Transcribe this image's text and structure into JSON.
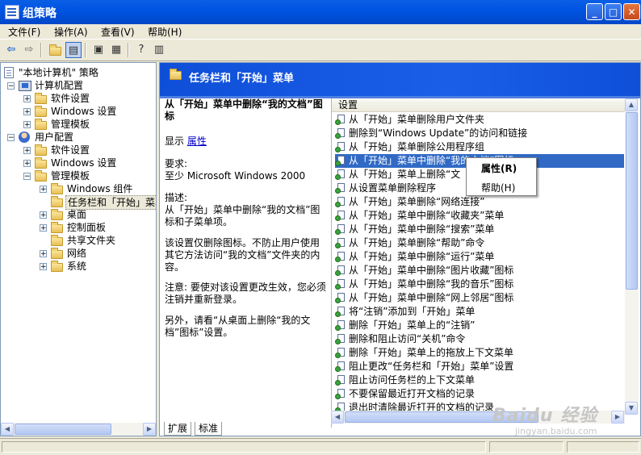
{
  "window": {
    "title": "组策略"
  },
  "menu": [
    "文件(F)",
    "操作(A)",
    "查看(V)",
    "帮助(H)"
  ],
  "toolbar": {
    "back": "⇦",
    "forward": "⇨"
  },
  "tree": {
    "root": "\"本地计算机\" 策略",
    "computer": "计算机配置",
    "c_software": "软件设置",
    "c_windows": "Windows 设置",
    "c_admin": "管理模板",
    "user": "用户配置",
    "u_software": "软件设置",
    "u_windows": "Windows 设置",
    "u_admin": "管理模板",
    "win_comp": "Windows 组件",
    "taskbar": "任务栏和「开始」菜单",
    "desktop": "桌面",
    "control": "控制面板",
    "shared": "共享文件夹",
    "network": "网络",
    "system": "系统"
  },
  "header": {
    "title": "任务栏和「开始」菜单"
  },
  "desc": {
    "title": "从「开始」菜单中删除“我的文档”图标",
    "show_label": "显示",
    "show_link": "属性",
    "req_label": "要求:",
    "req_text": "至少 Microsoft Windows 2000",
    "desc_label": "描述:",
    "desc_text": "从「开始」菜单中删除“我的文档”图标和子菜单项。",
    "p2": "该设置仅删除图标。不防止用户使用其它方法访问“我的文档”文件夹的内容。",
    "p3": "注意: 要使对该设置更改生效，您必须注销并重新登录。",
    "p4": "另外，请看“从桌面上删除“我的文档”图标”设置。"
  },
  "list": {
    "header": "设置",
    "items": [
      "从「开始」菜单删除用户文件夹",
      "删除到“Windows Update”的访问和链接",
      "从「开始」菜单删除公用程序组",
      "从「开始」菜单中删除“我的文档”图标",
      "从「开始」菜单上删除“文",
      "从设置菜单删除程序",
      "从「开始」菜单删除“网络连接”",
      "从「开始」菜单中删除“收藏夹”菜单",
      "从「开始」菜单中删除“搜索”菜单",
      "从「开始」菜单删除“帮助”命令",
      "从「开始」菜单中删除“运行”菜单",
      "从「开始」菜单中删除“图片收藏”图标",
      "从「开始」菜单中删除“我的音乐”图标",
      "从「开始」菜单中删除“网上邻居”图标",
      "将“注销”添加到「开始」菜单",
      "删除「开始」菜单上的“注销”",
      "删除和阻止访问“关机”命令",
      "删除「开始」菜单上的拖放上下文菜单",
      "阻止更改“任务栏和「开始」菜单”设置",
      "阻止访问任务栏的上下文菜单",
      "不要保留最近打开文档的记录",
      "退出时清除最近打开的文档的记录"
    ],
    "selected_index": 3
  },
  "context_menu": {
    "properties": "属性(R)",
    "help": "帮助(H)"
  },
  "tabs": [
    "扩展",
    "标准"
  ],
  "watermark": {
    "logo": "Baidu 经验",
    "url": "jingyan.baidu.com"
  }
}
